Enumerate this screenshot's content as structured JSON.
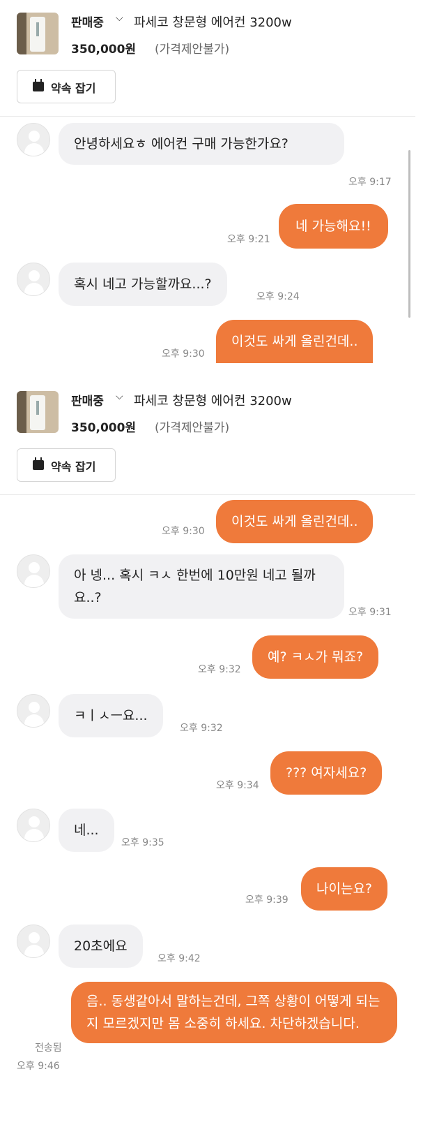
{
  "product": {
    "status": "판매중",
    "status_chevron": "⌵",
    "title": "파세코 창문형 에어컨 3200w",
    "price": "350,000원",
    "negotiation": "(가격제안불가)",
    "appointment_button": "약속 잡기",
    "calendar_icon": "calendar-icon"
  },
  "chat1": [
    {
      "dir": "in",
      "text": "안녕하세요ㅎ 에어컨 구매 가능한가요?",
      "time": "오후 9:17"
    },
    {
      "dir": "out",
      "text": "네 가능해요!!",
      "time": "오후 9:21"
    },
    {
      "dir": "in",
      "text": "혹시 네고 가능할까요...?",
      "time": "오후 9:24"
    },
    {
      "dir": "out",
      "text": "이것도 싸게 올린건데..",
      "time": "오후 9:30"
    }
  ],
  "chat2": [
    {
      "dir": "out",
      "text": "이것도 싸게 올린건데..",
      "time": "오후 9:30"
    },
    {
      "dir": "in",
      "text": "아 넹... 혹시 ㅋㅅ 한번에 10만원 네고 될까요..?",
      "time": "오후 9:31"
    },
    {
      "dir": "out",
      "text": "예? ㅋㅅ가 뭐죠?",
      "time": "오후 9:32"
    },
    {
      "dir": "in",
      "text": "ㅋㅣㅅㅡ요...",
      "time": "오후 9:32"
    },
    {
      "dir": "out",
      "text": "??? 여자세요?",
      "time": "오후 9:34"
    },
    {
      "dir": "in",
      "text": "네...",
      "time": "오후 9:35"
    },
    {
      "dir": "out",
      "text": "나이는요?",
      "time": "오후 9:39"
    },
    {
      "dir": "in",
      "text": "20초에요",
      "time": "오후 9:42"
    },
    {
      "dir": "out",
      "text": "음.. 동생같아서 말하는건데, 그쪽 상황이 어떻게 되는지 모르겠지만 몸 소중히 하세요. 차단하겠습니다.",
      "time": "오후 9:46",
      "status": "전송됨"
    }
  ],
  "colors": {
    "accent": "#ef7a3b",
    "incoming_bubble": "#f1f1f3",
    "time_text": "#888888"
  }
}
